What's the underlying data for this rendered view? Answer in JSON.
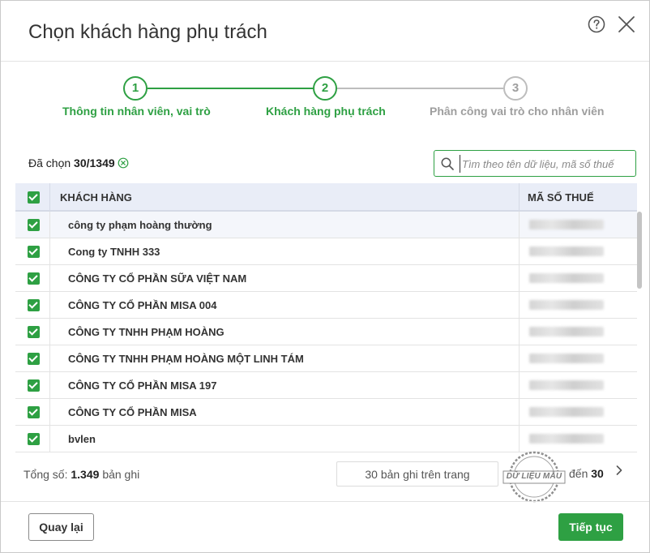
{
  "dialog": {
    "title": "Chọn khách hàng phụ trách"
  },
  "icons": {
    "help": "question-circle-icon",
    "close": "close-icon",
    "search": "search-icon",
    "clear": "clear-selection-icon",
    "next": "chevron-right-icon"
  },
  "colors": {
    "accent": "#2ea043",
    "inactive": "#9e9e9e",
    "header_bg": "#e9edf7"
  },
  "stepper": {
    "steps": [
      {
        "number": "1",
        "label": "Thông tin nhân viên, vai trò",
        "state": "done"
      },
      {
        "number": "2",
        "label": "Khách hàng phụ trách",
        "state": "active"
      },
      {
        "number": "3",
        "label": "Phân công vai trò cho nhân viên",
        "state": "pending"
      }
    ]
  },
  "selection": {
    "prefix": "Đã chọn",
    "count": "30/1349"
  },
  "search": {
    "placeholder": "Tìm theo tên dữ liệu, mã số thuế",
    "value": ""
  },
  "table": {
    "headers": {
      "customer": "KHÁCH HÀNG",
      "tax_code": "MÃ SỐ THUẾ"
    },
    "rows": [
      {
        "name": "công ty phạm hoàng thường",
        "checked": true
      },
      {
        "name": "Cong ty TNHH 333",
        "checked": true
      },
      {
        "name": "CÔNG TY CỔ PHẦN SỮA VIỆT NAM",
        "checked": true
      },
      {
        "name": "CÔNG TY CỔ PHẦN MISA 004",
        "checked": true
      },
      {
        "name": "CÔNG TY TNHH PHẠM HOÀNG",
        "checked": true
      },
      {
        "name": "CÔNG TY TNHH PHẠM HOÀNG MỘT LINH TÁM",
        "checked": true
      },
      {
        "name": "CÔNG TY CỔ PHẦN MISA 197",
        "checked": true
      },
      {
        "name": "CÔNG TY CỔ PHẦN MISA",
        "checked": true
      },
      {
        "name": "bvlen",
        "checked": true
      }
    ]
  },
  "pagination": {
    "total_prefix": "Tổng số:",
    "total_count": "1.349",
    "total_suffix": "bản ghi",
    "page_size": "30 bản ghi trên trang",
    "range_prefix": "đến",
    "range_end": "30"
  },
  "stamp": {
    "text": "DỮ LIỆU MẪU"
  },
  "buttons": {
    "back": "Quay lại",
    "next": "Tiếp tục"
  }
}
